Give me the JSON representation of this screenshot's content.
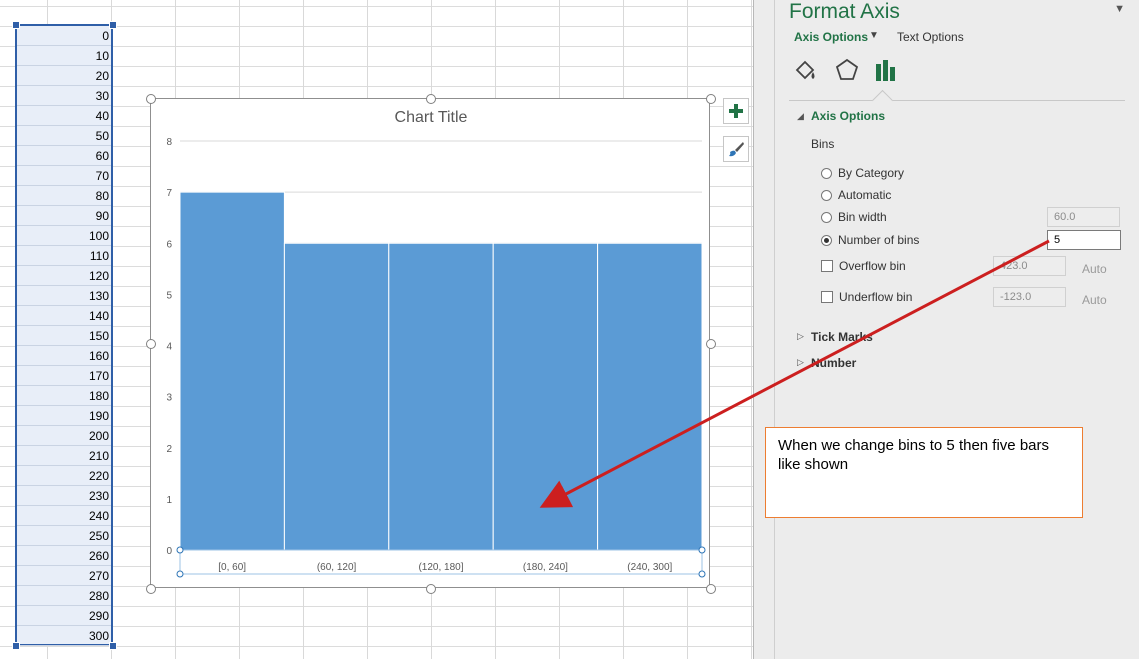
{
  "sheet": {
    "column_values": [
      "0",
      "10",
      "20",
      "30",
      "40",
      "50",
      "60",
      "70",
      "80",
      "90",
      "100",
      "110",
      "120",
      "130",
      "140",
      "150",
      "160",
      "170",
      "180",
      "190",
      "200",
      "210",
      "220",
      "230",
      "240",
      "250",
      "260",
      "270",
      "280",
      "290",
      "300"
    ]
  },
  "chart_data": {
    "type": "bar",
    "title": "Chart Title",
    "categories": [
      "[0, 60]",
      "(60, 120]",
      "(120, 180]",
      "(180, 240]",
      "(240, 300]"
    ],
    "values": [
      7,
      6,
      6,
      6,
      6
    ],
    "ylim": [
      0,
      8
    ],
    "yticks": [
      "0",
      "1",
      "2",
      "3",
      "4",
      "5",
      "6",
      "7",
      "8"
    ],
    "bar_color": "#5b9bd5",
    "grid": true,
    "xlabel": "",
    "ylabel": ""
  },
  "chart_buttons": {
    "elements_icon": "plus-icon",
    "styles_icon": "paintbrush-icon"
  },
  "pane": {
    "title": "Format Axis",
    "tab_axis_options": "Axis Options",
    "tab_text_options": "Text Options",
    "icons": [
      "fill-line-icon",
      "effects-pentagon-icon",
      "bar-chart-icon"
    ],
    "section_axis_options": "Axis Options",
    "bins_label": "Bins",
    "radio_by_category": "By Category",
    "radio_automatic": "Automatic",
    "radio_bin_width": "Bin width",
    "bin_width_value": "60.0",
    "radio_number_of_bins": "Number of bins",
    "number_of_bins_value": "5",
    "overflow_label": "Overflow bin",
    "overflow_value": "423.0",
    "underflow_label": "Underflow bin",
    "underflow_value": "-123.0",
    "auto_label": "Auto",
    "section_tick_marks": "Tick Marks",
    "section_number": "Number",
    "accent_color": "#217346"
  },
  "callout": {
    "text": "When we change bins to 5 then five bars like shown",
    "border_color": "#ed7d31",
    "arrow_color": "#cc1f1f"
  }
}
